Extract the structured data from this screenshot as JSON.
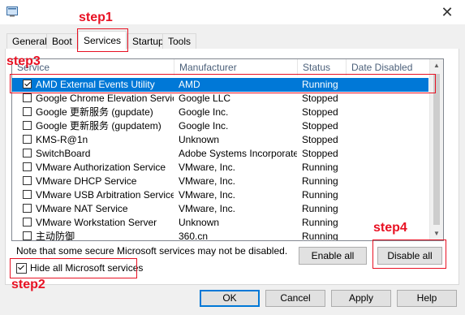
{
  "window": {
    "close_glyph": "✕",
    "close_icon": "close-icon"
  },
  "tabs": [
    "General",
    "Boot",
    "Services",
    "Startup",
    "Tools"
  ],
  "active_tab": "Services",
  "columns": [
    "Service",
    "Manufacturer",
    "Status",
    "Date Disabled"
  ],
  "services": [
    {
      "name": "AMD External Events Utility",
      "manufacturer": "AMD",
      "status": "Running",
      "checked": true,
      "selected": true
    },
    {
      "name": "Google Chrome Elevation Servic...",
      "manufacturer": "Google LLC",
      "status": "Stopped",
      "checked": false
    },
    {
      "name": "Google 更新服务 (gupdate)",
      "manufacturer": "Google Inc.",
      "status": "Stopped",
      "checked": false
    },
    {
      "name": "Google 更新服务 (gupdatem)",
      "manufacturer": "Google Inc.",
      "status": "Stopped",
      "checked": false
    },
    {
      "name": "KMS-R@1n",
      "manufacturer": "Unknown",
      "status": "Stopped",
      "checked": false
    },
    {
      "name": "SwitchBoard",
      "manufacturer": "Adobe Systems Incorporated",
      "status": "Stopped",
      "checked": false
    },
    {
      "name": "VMware Authorization Service",
      "manufacturer": "VMware, Inc.",
      "status": "Running",
      "checked": false
    },
    {
      "name": "VMware DHCP Service",
      "manufacturer": "VMware, Inc.",
      "status": "Running",
      "checked": false
    },
    {
      "name": "VMware USB Arbitration Service",
      "manufacturer": "VMware, Inc.",
      "status": "Running",
      "checked": false
    },
    {
      "name": "VMware NAT Service",
      "manufacturer": "VMware, Inc.",
      "status": "Running",
      "checked": false
    },
    {
      "name": "VMware Workstation Server",
      "manufacturer": "Unknown",
      "status": "Running",
      "checked": false
    },
    {
      "name": "主动防御",
      "manufacturer": "360.cn",
      "status": "Running",
      "checked": false
    }
  ],
  "note": "Note that some secure Microsoft services may not be disabled.",
  "buttons": {
    "enable_all": "Enable all",
    "disable_all": "Disable all",
    "ok": "OK",
    "cancel": "Cancel",
    "apply": "Apply",
    "help": "Help"
  },
  "hide_ms": {
    "label": "Hide all Microsoft services",
    "checked": true
  },
  "annotations": [
    "step1",
    "step2",
    "step3",
    "step4"
  ],
  "colors": {
    "annotation": "#e81123",
    "selection": "#0078d7"
  }
}
